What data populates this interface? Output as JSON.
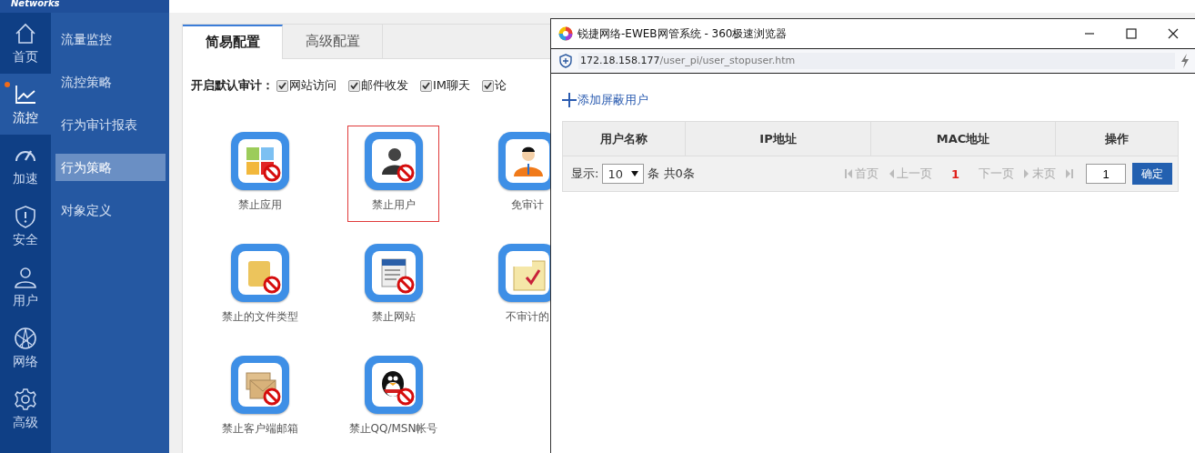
{
  "logo": {
    "text": "Networks"
  },
  "rail": [
    {
      "label": "首页",
      "kind": "home",
      "selected": false,
      "dot": false
    },
    {
      "label": "流控",
      "kind": "chart",
      "selected": true,
      "dot": true
    },
    {
      "label": "加速",
      "kind": "gauge",
      "selected": false,
      "dot": false
    },
    {
      "label": "安全",
      "kind": "shield",
      "selected": false,
      "dot": false
    },
    {
      "label": "用户",
      "kind": "user",
      "selected": false,
      "dot": false
    },
    {
      "label": "网络",
      "kind": "globe",
      "selected": false,
      "dot": false
    },
    {
      "label": "高级",
      "kind": "gear",
      "selected": false,
      "dot": false
    }
  ],
  "subnav": [
    {
      "label": "流量监控",
      "selected": false
    },
    {
      "label": "流控策略",
      "selected": false
    },
    {
      "label": "行为审计报表",
      "selected": false
    },
    {
      "label": "行为策略",
      "selected": true
    },
    {
      "label": "对象定义",
      "selected": false
    }
  ],
  "tabs": [
    {
      "label": "简易配置",
      "selected": true
    },
    {
      "label": "高级配置",
      "selected": false
    }
  ],
  "audit": {
    "label": "开启默认审计：",
    "options": [
      {
        "label": "网站访问",
        "checked": true
      },
      {
        "label": "邮件收发",
        "checked": true
      },
      {
        "label": "IM聊天",
        "checked": true
      },
      {
        "label": "论",
        "checked": true
      }
    ]
  },
  "policies": [
    {
      "label": "禁止应用",
      "kind": "apps",
      "selected": false
    },
    {
      "label": "禁止用户",
      "kind": "user",
      "selected": true
    },
    {
      "label": "免审计",
      "kind": "person",
      "selected": false
    },
    {
      "label": "禁止的文件类型",
      "kind": "file",
      "selected": false
    },
    {
      "label": "禁止网站",
      "kind": "web",
      "selected": false
    },
    {
      "label": "不审计的",
      "kind": "url",
      "selected": false
    },
    {
      "label": "禁止客户端邮箱",
      "kind": "mail",
      "selected": false
    },
    {
      "label": "禁止QQ/MSN帐号",
      "kind": "qq",
      "selected": false
    }
  ],
  "popup": {
    "title": "锐捷网络-EWEB网管系统 - 360极速浏览器",
    "url_host": "172.18.158.177",
    "url_path": "/user_pi/user_stopuser.htm",
    "add_link": "添加屏蔽用户",
    "table": {
      "columns": [
        "用户名称",
        "IP地址",
        "MAC地址",
        "操作"
      ]
    },
    "footer": {
      "show_label": "显示:",
      "page_size": "10",
      "count_text": "条 共0条",
      "pager": [
        {
          "label": "首页",
          "kind": "first",
          "disabled": true
        },
        {
          "label": "上一页",
          "kind": "prev",
          "disabled": true
        },
        {
          "label": "1",
          "kind": "current",
          "disabled": false
        },
        {
          "label": "下一页",
          "kind": "next",
          "disabled": true
        },
        {
          "label": "末页",
          "kind": "last",
          "disabled": true
        }
      ],
      "page_input": "1",
      "go_button": "确定"
    }
  }
}
